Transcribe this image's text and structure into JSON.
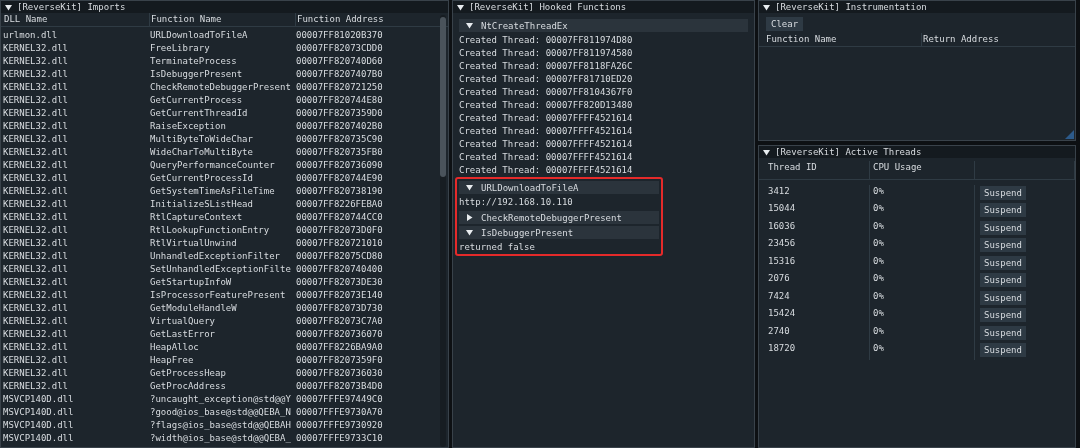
{
  "imports": {
    "title": "[ReverseKit] Imports",
    "columns": [
      "DLL Name",
      "Function Name",
      "Function Address"
    ],
    "rows": [
      [
        "urlmon.dll",
        "URLDownloadToFileA",
        "00007FF81020B370"
      ],
      [
        "KERNEL32.dll",
        "FreeLibrary",
        "00007FF82073CDD0"
      ],
      [
        "KERNEL32.dll",
        "TerminateProcess",
        "00007FF820740D60"
      ],
      [
        "KERNEL32.dll",
        "IsDebuggerPresent",
        "00007FF8207407B0"
      ],
      [
        "KERNEL32.dll",
        "CheckRemoteDebuggerPresent",
        "00007FF820721250"
      ],
      [
        "KERNEL32.dll",
        "GetCurrentProcess",
        "00007FF820744E80"
      ],
      [
        "KERNEL32.dll",
        "GetCurrentThreadId",
        "00007FF8207359D0"
      ],
      [
        "KERNEL32.dll",
        "RaiseException",
        "00007FF8207402B0"
      ],
      [
        "KERNEL32.dll",
        "MultiByteToWideChar",
        "00007FF820735C90"
      ],
      [
        "KERNEL32.dll",
        "WideCharToMultiByte",
        "00007FF820735FB0"
      ],
      [
        "KERNEL32.dll",
        "QueryPerformanceCounter",
        "00007FF820736090"
      ],
      [
        "KERNEL32.dll",
        "GetCurrentProcessId",
        "00007FF820744E90"
      ],
      [
        "KERNEL32.dll",
        "GetSystemTimeAsFileTime",
        "00007FF820738190"
      ],
      [
        "KERNEL32.dll",
        "InitializeSListHead",
        "00007FF8226FEBA0"
      ],
      [
        "KERNEL32.dll",
        "RtlCaptureContext",
        "00007FF820744CC0"
      ],
      [
        "KERNEL32.dll",
        "RtlLookupFunctionEntry",
        "00007FF82073D0F0"
      ],
      [
        "KERNEL32.dll",
        "RtlVirtualUnwind",
        "00007FF820721010"
      ],
      [
        "KERNEL32.dll",
        "UnhandledExceptionFilter",
        "00007FF82075CD80"
      ],
      [
        "KERNEL32.dll",
        "SetUnhandledExceptionFilte",
        "00007FF820740400"
      ],
      [
        "KERNEL32.dll",
        "GetStartupInfoW",
        "00007FF82073DE30"
      ],
      [
        "KERNEL32.dll",
        "IsProcessorFeaturePresent",
        "00007FF82073E140"
      ],
      [
        "KERNEL32.dll",
        "GetModuleHandleW",
        "00007FF82073D730"
      ],
      [
        "KERNEL32.dll",
        "VirtualQuery",
        "00007FF82073C7A0"
      ],
      [
        "KERNEL32.dll",
        "GetLastError",
        "00007FF820736070"
      ],
      [
        "KERNEL32.dll",
        "HeapAlloc",
        "00007FF8226BA9A0"
      ],
      [
        "KERNEL32.dll",
        "HeapFree",
        "00007FF8207359F0"
      ],
      [
        "KERNEL32.dll",
        "GetProcessHeap",
        "00007FF820736030"
      ],
      [
        "KERNEL32.dll",
        "GetProcAddress",
        "00007FF82073B4D0"
      ],
      [
        "MSVCP140D.dll",
        "?uncaught_exception@std@@Y",
        "00007FFFE97449C0"
      ],
      [
        "MSVCP140D.dll",
        "?good@ios_base@std@@QEBA_N",
        "00007FFFE9730A70"
      ],
      [
        "MSVCP140D.dll",
        "?flags@ios_base@std@@QEBAH",
        "00007FFFE9730920"
      ],
      [
        "MSVCP140D.dll",
        "?width@ios_base@std@@QEBA_",
        "00007FFFE9733C10"
      ]
    ]
  },
  "hooked": {
    "title": "[ReverseKit] Hooked Functions",
    "sections": [
      {
        "name": "NtCreateThreadEx",
        "expanded": true,
        "highlighted": false,
        "lines": [
          "Created Thread: 00007FF811974D80",
          "Created Thread: 00007FF811974580",
          "Created Thread: 00007FF8118FA26C",
          "Created Thread: 00007FF81710ED20",
          "Created Thread: 00007FF8104367F0",
          "Created Thread: 00007FF820D13480",
          "Created Thread: 00007FFFF4521614",
          "Created Thread: 00007FFFF4521614",
          "Created Thread: 00007FFFF4521614",
          "Created Thread: 00007FFFF4521614",
          "Created Thread: 00007FFFF4521614"
        ]
      },
      {
        "name": "URLDownloadToFileA",
        "expanded": true,
        "highlighted": true,
        "lines": [
          "http://192.168.10.110"
        ]
      },
      {
        "name": "CheckRemoteDebuggerPresent",
        "expanded": false,
        "highlighted": true
      },
      {
        "name": "IsDebuggerPresent",
        "expanded": true,
        "highlighted": true,
        "lines": [
          "returned false"
        ]
      }
    ]
  },
  "instrumentation": {
    "title": "[ReverseKit] Instrumentation",
    "button": "Clear",
    "columns": [
      "Function Name",
      "Return Address"
    ]
  },
  "threads": {
    "title": "[ReverseKit] Active Threads",
    "columns": [
      "Thread ID",
      "CPU Usage"
    ],
    "rows": [
      {
        "id": "3412",
        "cpu": "0%",
        "action": "Suspend"
      },
      {
        "id": "15044",
        "cpu": "0%",
        "action": "Suspend"
      },
      {
        "id": "16036",
        "cpu": "0%",
        "action": "Suspend"
      },
      {
        "id": "23456",
        "cpu": "0%",
        "action": "Suspend"
      },
      {
        "id": "15316",
        "cpu": "0%",
        "action": "Suspend"
      },
      {
        "id": "2076",
        "cpu": "0%",
        "action": "Suspend"
      },
      {
        "id": "7424",
        "cpu": "0%",
        "action": "Suspend"
      },
      {
        "id": "15424",
        "cpu": "0%",
        "action": "Suspend"
      },
      {
        "id": "2740",
        "cpu": "0%",
        "action": "Suspend"
      },
      {
        "id": "18720",
        "cpu": "0%",
        "action": "Suspend"
      }
    ]
  }
}
